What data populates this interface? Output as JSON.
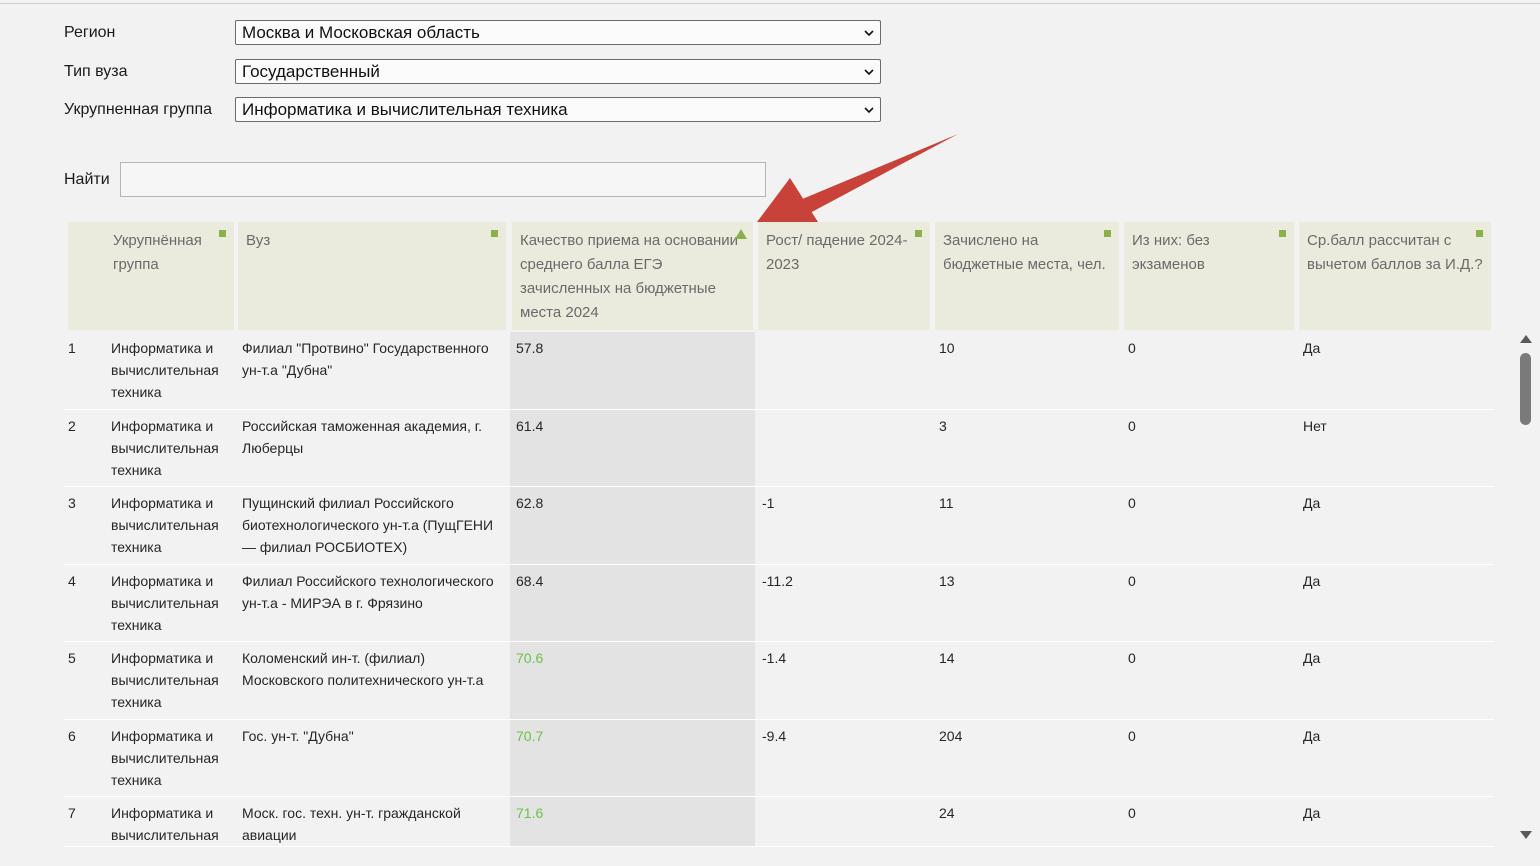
{
  "filters": {
    "region": {
      "label": "Регион",
      "value": "Москва и Московская область"
    },
    "uni_type": {
      "label": "Тип вуза",
      "value": "Государственный"
    },
    "group": {
      "label": "Укрупненная группа",
      "value": "Информатика и вычислительная техника"
    }
  },
  "search": {
    "label": "Найти",
    "value": ""
  },
  "table": {
    "headers": {
      "group": "Укрупнённая группа",
      "university": "Вуз",
      "quality": "Качество приема на основании среднего балла ЕГЭ зачисленных на бюджетные места 2024",
      "growth": "Рост/ падение 2024-2023",
      "enrolled": "Зачислено на бюджетные места, чел.",
      "no_exams": "Из них: без экзаменов",
      "id_deducted": "Ср.балл рассчитан с вычетом баллов за И.Д.?"
    },
    "rows": [
      {
        "n": "1",
        "group": "Информатика и вычислительная техника",
        "uni": "Филиал \"Протвино\" Государственного ун-т.а \"Дубна\"",
        "quality": "57.8",
        "growth": "",
        "enrolled": "10",
        "no_exams": "0",
        "id": "Да"
      },
      {
        "n": "2",
        "group": "Информатика и вычислительная техника",
        "uni": "Российская таможенная академия, г. Люберцы",
        "quality": "61.4",
        "growth": "",
        "enrolled": "3",
        "no_exams": "0",
        "id": "Нет"
      },
      {
        "n": "3",
        "group": "Информатика и вычислительная техника",
        "uni": "Пущинский филиал Российского биотехнологического ун-т.а (ПущГЕНИ — филиал РОСБИОТЕХ)",
        "quality": "62.8",
        "growth": "-1",
        "enrolled": "11",
        "no_exams": "0",
        "id": "Да"
      },
      {
        "n": "4",
        "group": "Информатика и вычислительная техника",
        "uni": "Филиал Российского технологического ун-т.а - МИРЭА в г. Фрязино",
        "quality": "68.4",
        "growth": "-11.2",
        "enrolled": "13",
        "no_exams": "0",
        "id": "Да"
      },
      {
        "n": "5",
        "group": "Информатика и вычислительная техника",
        "uni": "Коломенский ин-т. (филиал) Московского политехнического ун-т.а",
        "quality": "70.6",
        "growth": "-1.4",
        "enrolled": "14",
        "no_exams": "0",
        "id": "Да"
      },
      {
        "n": "6",
        "group": "Информатика и вычислительная техника",
        "uni": "Гос. ун-т. \"Дубна\"",
        "quality": "70.7",
        "growth": "-9.4",
        "enrolled": "204",
        "no_exams": "0",
        "id": "Да"
      },
      {
        "n": "7",
        "group": "Информатика и вычислительная",
        "uni": "Моск. гос. техн. ун-т. гражданской авиации",
        "quality": "71.6",
        "growth": "",
        "enrolled": "24",
        "no_exams": "0",
        "id": "Да"
      }
    ]
  },
  "colors": {
    "accent_green": "#8ab04b",
    "good_value": "#6cc04a",
    "arrow_red": "#c9423a"
  }
}
